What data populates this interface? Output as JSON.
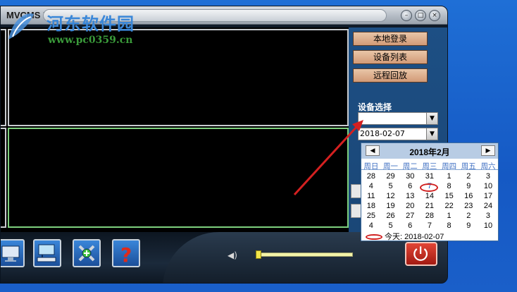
{
  "window": {
    "title": "MVCMS Lite",
    "buttons": [
      "minimize",
      "restore",
      "close"
    ]
  },
  "watermark": {
    "site_name": "河东软件园",
    "url": "www.pc0359.cn"
  },
  "side_panel": {
    "buttons": [
      {
        "label": "本地登录"
      },
      {
        "label": "设备列表"
      },
      {
        "label": "远程回放"
      }
    ],
    "section_label": "设备选择",
    "device_select": {
      "value": ""
    },
    "date_select": {
      "value": "2018-02-07"
    }
  },
  "calendar": {
    "title": "2018年2月",
    "weekdays": [
      "周日",
      "周一",
      "周二",
      "周三",
      "周四",
      "周五",
      "周六"
    ],
    "weeks": [
      [
        "28",
        "29",
        "30",
        "31",
        "1",
        "2",
        "3"
      ],
      [
        "4",
        "5",
        "6",
        "7",
        "8",
        "9",
        "10"
      ],
      [
        "11",
        "12",
        "13",
        "14",
        "15",
        "16",
        "17"
      ],
      [
        "18",
        "19",
        "20",
        "21",
        "22",
        "23",
        "24"
      ],
      [
        "25",
        "26",
        "27",
        "28",
        "1",
        "2",
        "3"
      ],
      [
        "4",
        "5",
        "6",
        "7",
        "8",
        "9",
        "10"
      ]
    ],
    "selected_day": "7",
    "today_text": "今天: 2018-02-07"
  },
  "bottom_toolbar": {
    "tools": [
      {
        "icon": "monitor-icon"
      },
      {
        "icon": "computer-network-icon"
      },
      {
        "icon": "tools-icon"
      },
      {
        "icon": "help-icon"
      }
    ],
    "volume_level": 0.05,
    "power_icon": "power-icon"
  },
  "colors": {
    "menu_button": "#d29a77",
    "panel": "#1d4f84",
    "pane_active_border": "#7ed07e",
    "annotation_red": "#d02020"
  }
}
